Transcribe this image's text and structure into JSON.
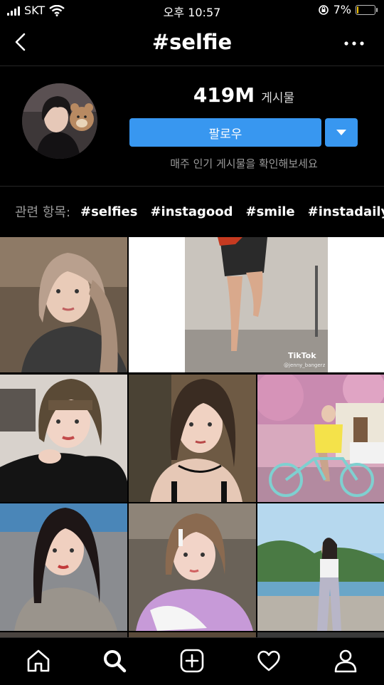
{
  "status_bar": {
    "carrier": "SKT",
    "time": "오후 10:57",
    "battery_percent": "7%",
    "battery_level": 0.07
  },
  "nav": {
    "title": "#selfie",
    "back_icon": "chevron-left-icon",
    "more_icon": "more-horizontal-icon"
  },
  "header": {
    "post_count": "419M",
    "post_label": "게시물",
    "follow_label": "팔로우",
    "hint": "매주 인기 게시물을 확인해보세요"
  },
  "related": {
    "label": "관련 항목:",
    "tags": [
      "#selfies",
      "#instagood",
      "#smile",
      "#instadaily"
    ]
  },
  "grid": {
    "tiktok_watermark": "TikTok",
    "tiktok_user": "@jenny_bangerz"
  },
  "tabs": [
    {
      "name": "home",
      "icon": "home-icon"
    },
    {
      "name": "search",
      "icon": "search-icon",
      "active": true
    },
    {
      "name": "new-post",
      "icon": "plus-square-icon"
    },
    {
      "name": "activity",
      "icon": "heart-icon"
    },
    {
      "name": "profile",
      "icon": "person-icon"
    }
  ],
  "colors": {
    "accent": "#3897f0",
    "background": "#000000",
    "muted": "#9a9a9a",
    "battery": "#f5c400"
  }
}
